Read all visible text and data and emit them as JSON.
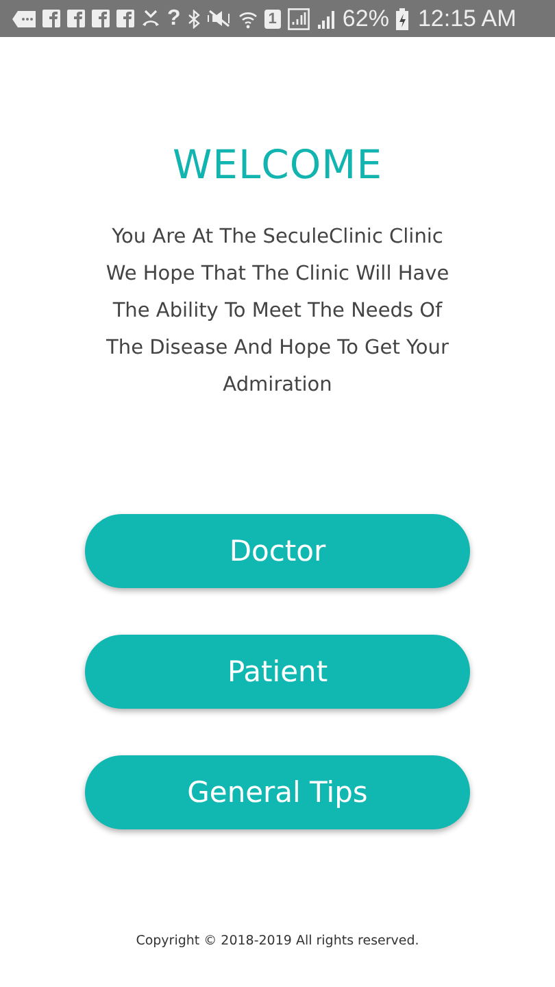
{
  "status_bar": {
    "unknown_mark": "?",
    "sim_label": "1",
    "battery": "62%",
    "time": "12:15 AM"
  },
  "welcome": {
    "title": "WELCOME",
    "lines": [
      "You Are At The SeculeClinic Clinic",
      "We Hope That The Clinic Will Have",
      "The Ability To Meet The Needs Of",
      "The Disease And Hope To Get Your",
      "Admiration"
    ]
  },
  "buttons": [
    "Doctor",
    "Patient",
    "General Tips"
  ],
  "footer": "Copyright © 2018-2019 All rights reserved."
}
